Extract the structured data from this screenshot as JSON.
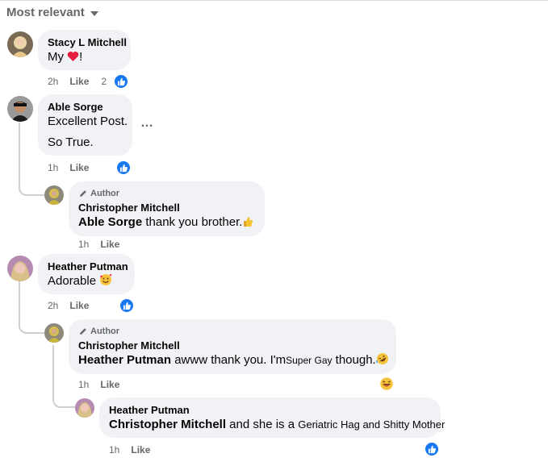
{
  "sort": {
    "label": "Most relevant"
  },
  "comments": [
    {
      "name": "Stacy L Mitchell",
      "text_before": "My ",
      "text_after": "!",
      "emoji": "heart",
      "time": "2h",
      "like_label": "Like",
      "reaction_count": "2"
    },
    {
      "name": "Able Sorge",
      "line1": "Excellent Post.",
      "line2": "So True.",
      "time": "1h",
      "like_label": "Like",
      "more": "…"
    },
    {
      "badge": "Author",
      "name": "Christopher Mitchell",
      "mention": "Able Sorge",
      "text": " thank you brother.",
      "emoji": "thumbs-up-emoji",
      "time": "1h",
      "like_label": "Like"
    },
    {
      "name": "Heather Putman",
      "text": "Adorable ",
      "emoji": "smiling-face-with-hearts",
      "time": "2h",
      "like_label": "Like"
    },
    {
      "badge": "Author",
      "name": "Christopher Mitchell",
      "mention": "Heather Putman",
      "text": " awww thank you. I'm",
      "small_text": "Super Gay",
      "text_end": " though.",
      "emoji": "rolling-on-floor-laughing",
      "time": "1h",
      "like_label": "Like"
    },
    {
      "name": "Heather Putman",
      "mention": "Christopher Mitchell",
      "text": " and she is a ",
      "small_text": "Geriatric Hag and Shitty Mother",
      "time": "1h",
      "like_label": "Like"
    }
  ],
  "colors": {
    "bubble": "#f0f2f5",
    "meta": "#65676b",
    "like_blue": "#1877f2",
    "heart": "#e41e3f"
  }
}
